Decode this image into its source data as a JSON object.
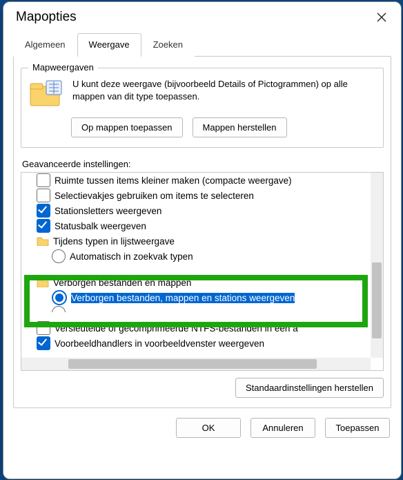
{
  "title": "Mapopties",
  "tabs": {
    "general": "Algemeen",
    "view": "Weergave",
    "search": "Zoeken",
    "active": "view"
  },
  "mapweergaven": {
    "title": "Mapweergaven",
    "desc": "U kunt deze weergave (bijvoorbeeld Details of Pictogrammen) op alle mappen van dit type toepassen.",
    "apply": "Op mappen toepassen",
    "reset": "Mappen herstellen"
  },
  "advanced_label": "Geavanceerde instellingen:",
  "tree": {
    "items": [
      {
        "kind": "checkbox",
        "indent": 1,
        "checked": false,
        "label": "Ruimte tussen items kleiner maken (compacte weergave)"
      },
      {
        "kind": "checkbox",
        "indent": 1,
        "checked": false,
        "label": "Selectievakjes gebruiken om items te selecteren"
      },
      {
        "kind": "checkbox",
        "indent": 1,
        "checked": true,
        "label": "Stationsletters weergeven"
      },
      {
        "kind": "checkbox",
        "indent": 1,
        "checked": true,
        "label": "Statusbalk weergeven"
      },
      {
        "kind": "folder",
        "indent": 1,
        "label": "Tijdens typen in lijstweergave"
      },
      {
        "kind": "radio",
        "indent": 2,
        "checked": false,
        "label": "Automatisch in zoekvak typen"
      },
      {
        "kind": "spacer"
      },
      {
        "kind": "folder",
        "indent": 1,
        "label": "Verborgen bestanden en mappen"
      },
      {
        "kind": "radio",
        "indent": 2,
        "checked": true,
        "selected": true,
        "label": "Verborgen bestanden, mappen en stations weergeven"
      },
      {
        "kind": "radio",
        "indent": 2,
        "checked": false,
        "partial": true,
        "label": ""
      },
      {
        "kind": "checkbox",
        "indent": 1,
        "checked": false,
        "label": "Versleutelde of gecomprimeerde NTFS-bestanden in een a"
      },
      {
        "kind": "checkbox",
        "indent": 1,
        "checked": true,
        "label": "Voorbeeldhandlers in voorbeeldvenster weergeven"
      }
    ]
  },
  "restore_defaults": "Standaardinstellingen herstellen",
  "buttons": {
    "ok": "OK",
    "cancel": "Annuleren",
    "apply": "Toepassen"
  }
}
